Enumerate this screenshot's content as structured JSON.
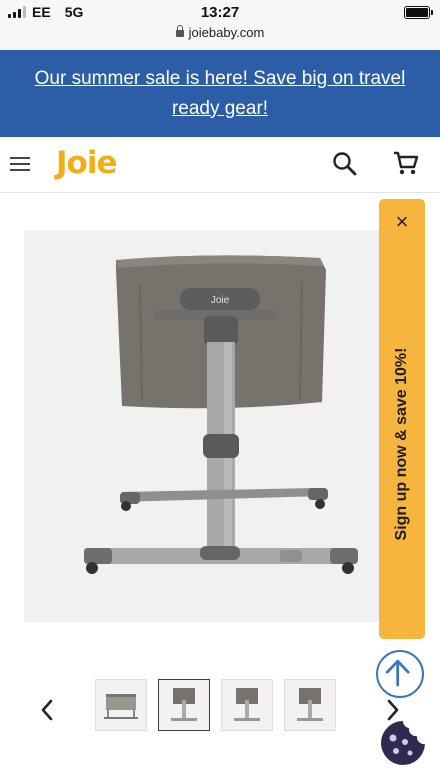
{
  "status_bar": {
    "carrier": "EE",
    "network": "5G",
    "time": "13:27",
    "url": "joiebaby.com"
  },
  "promo_banner": {
    "text": "Our summer sale is here! Save big on travel ready gear!"
  },
  "header": {
    "logo_text": "Joie",
    "menu_icon": "hamburger-menu-icon",
    "search_icon": "search-icon",
    "cart_icon": "shopping-cart-icon"
  },
  "product_gallery": {
    "main_image_label": "Joie",
    "thumbnail_count": 4,
    "active_thumbnail": 2
  },
  "signup_tab": {
    "label": "Sign up now & save 10%!",
    "close_label": "×"
  },
  "colors": {
    "banner_bg": "#2b5ea7",
    "brand_yellow": "#f2ae17",
    "signup_bg": "#f6b53c",
    "accent_blue": "#3b73c0",
    "cookie_purple": "#2f2a4f"
  }
}
